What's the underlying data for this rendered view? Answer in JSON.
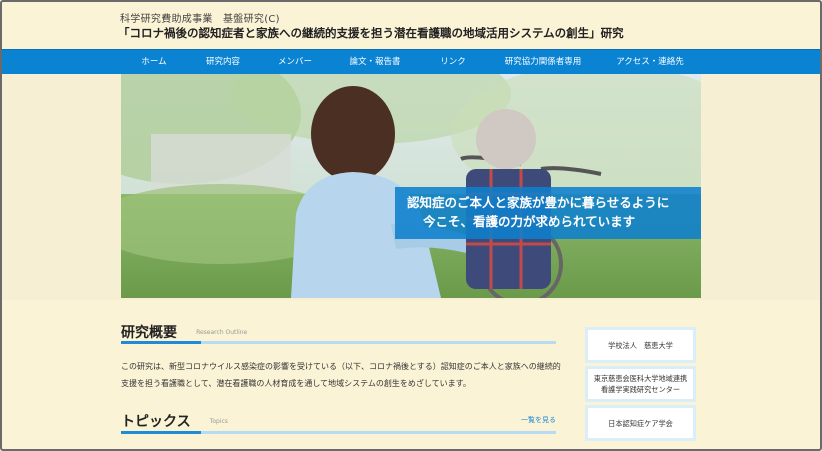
{
  "header": {
    "subtitle": "科学研究費助成事業　基盤研究(C)",
    "title": "「コロナ禍後の認知症者と家族への継続的支援を担う潜在看護職の地域活用システムの創生」研究"
  },
  "nav": {
    "items": [
      {
        "label": "ホーム"
      },
      {
        "label": "研究内容"
      },
      {
        "label": "メンバー"
      },
      {
        "label": "論文・報告書"
      },
      {
        "label": "リンク"
      },
      {
        "label": "研究協力関係者専用"
      },
      {
        "label": "アクセス・連絡先"
      }
    ]
  },
  "hero": {
    "caption_line1": "認知症のご本人と家族が豊かに暮らせるように",
    "caption_line2": "今こそ、看護の力が求められています"
  },
  "overview": {
    "heading": "研究概要",
    "heading_en": "Research Outline",
    "text": "この研究は、新型コロナウイルス感染症の影響を受けている（以下、コロナ禍後とする）認知症のご本人と家族への継続的支援を担う看護職として、潜在看護職の人材育成を通して地域システムの創生をめざしています。"
  },
  "topics": {
    "heading": "トピックス",
    "heading_en": "Topics",
    "more_link": "一覧を見る"
  },
  "sidebar": {
    "links": [
      {
        "label": "学校法人　慈恵大学"
      },
      {
        "label": "東京慈恵会医科大学地域連携\n看護学実践研究センター"
      },
      {
        "label": "日本認知症ケア学会"
      }
    ]
  },
  "colors": {
    "nav": "#0b83d3",
    "page_background": "#fbf3d6",
    "caption": "#0e80cd",
    "accent_rule": "#1f8bd7"
  }
}
